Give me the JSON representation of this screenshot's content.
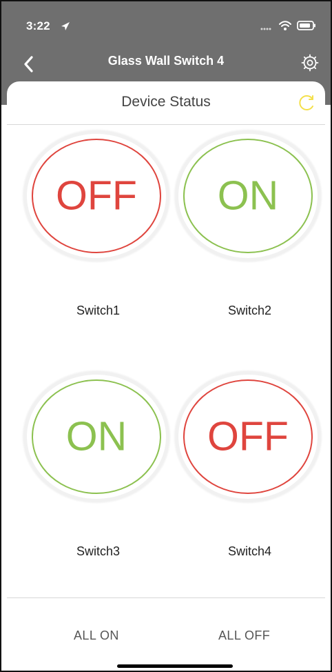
{
  "status_bar": {
    "time": "3:22",
    "icons": [
      "location-arrow-icon",
      "signal-dots-icon",
      "wifi-icon",
      "battery-icon"
    ]
  },
  "nav": {
    "title": "Glass Wall Switch 4",
    "icons": [
      "back-chevron-icon",
      "settings-gear-icon"
    ]
  },
  "panel": {
    "title": "Device Status",
    "icons": [
      "refresh-icon"
    ]
  },
  "switches": [
    {
      "state": "OFF",
      "label": "Switch1"
    },
    {
      "state": "ON",
      "label": "Switch2"
    },
    {
      "state": "ON",
      "label": "Switch3"
    },
    {
      "state": "OFF",
      "label": "Switch4"
    }
  ],
  "footer": {
    "all_on": "ALL ON",
    "all_off": "ALL OFF"
  },
  "colors": {
    "header": "#6f6f6f",
    "on": "#8cc150",
    "off": "#df453e",
    "refresh": "#f4e04a",
    "text": "#444444"
  }
}
